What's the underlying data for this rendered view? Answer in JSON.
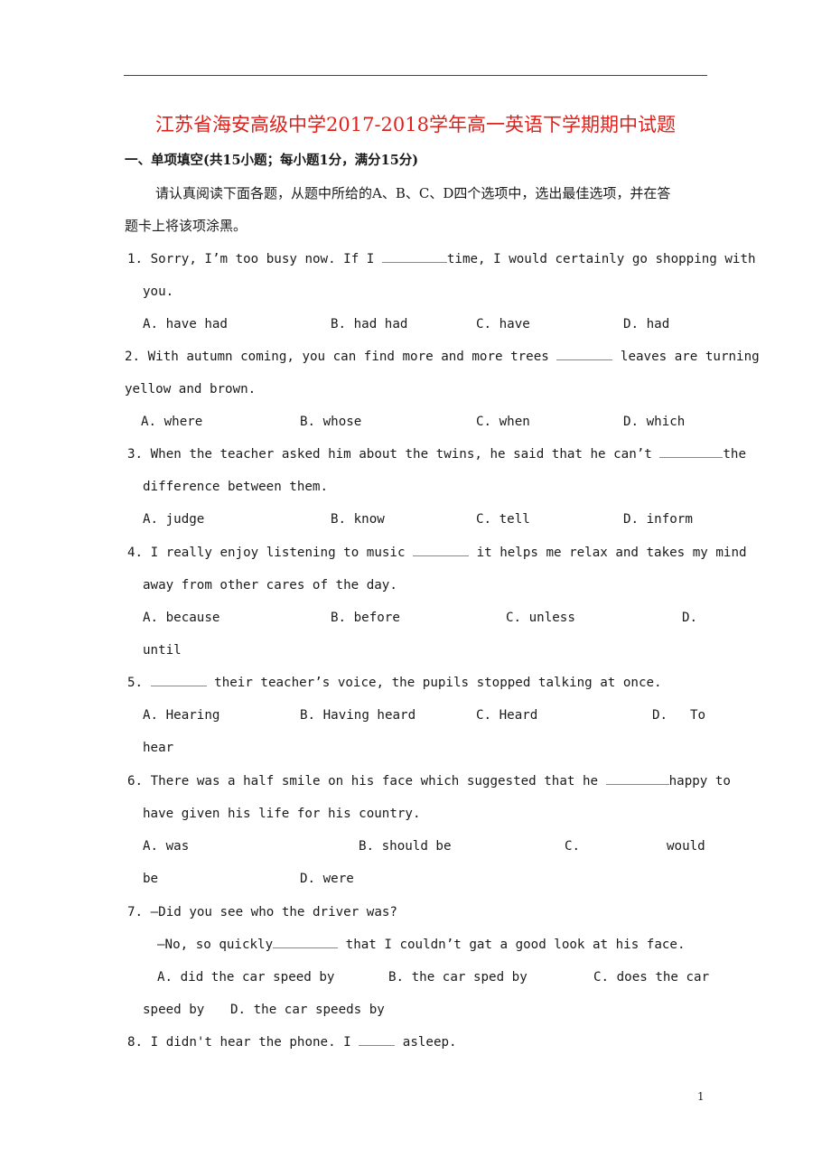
{
  "title": "江苏省海安高级中学2017-2018学年高一英语下学期期中试题",
  "section": "一、单项填空(共15小题；每小题1分，满分15分)",
  "instructions": {
    "line1": "请认真阅读下面各题，从题中所给的A、B、C、D四个选项中，选出最佳选项，并在答",
    "line2": "题卡上将该项涂黑。"
  },
  "questions": [
    {
      "number": "1.",
      "lines": [
        "Sorry, I’m too busy now. If I ",
        "time, I would certainly go shopping with",
        "you."
      ],
      "options": {
        "A": "A.  have had",
        "B": "B.  had had",
        "C": "C.  have",
        "D": "D.  had"
      }
    },
    {
      "number": "2.",
      "lines": [
        "With autumn coming, you can find more and more trees ",
        " leaves are turning",
        "yellow and brown."
      ],
      "options": {
        "A": "A.  where",
        "B": "B.  whose",
        "C": "C.  when",
        "D": "D.  which"
      }
    },
    {
      "number": "3.",
      "lines": [
        "When the teacher asked him about the twins, he said that he can’t ",
        "the",
        "difference between them."
      ],
      "options": {
        "A": "A.  judge",
        "B": "B.  know",
        "C": "C.  tell",
        "D": "D.  inform"
      }
    },
    {
      "number": "4.",
      "lines": [
        "I really enjoy listening to music ",
        " it helps me relax and takes my mind",
        "away from other cares of the day."
      ],
      "options": {
        "A": "A.  because",
        "B": "B.  before",
        "C": "C.  unless",
        "D": "D.",
        "D_cont": "until"
      }
    },
    {
      "number": "5.",
      "lines": [
        "",
        " their teacher’s voice, the pupils stopped talking at once."
      ],
      "options": {
        "A": "A.  Hearing",
        "B": "B.  Having heard",
        "C": "C.  Heard",
        "D": "D.",
        "D_word": "To",
        "D_cont": "hear"
      }
    },
    {
      "number": "6.",
      "lines": [
        "There was a half smile on his face which suggested that he ",
        "happy to",
        "have given his life for his country."
      ],
      "options": {
        "A": "A.  was",
        "B": "B.  should be",
        "C": "C.",
        "C_word": "would",
        "C_cont": "be",
        "D": "D.  were"
      }
    },
    {
      "number": "7.",
      "lines": [
        "—Did you see who the driver was?",
        "—No, so quickly",
        " that I couldn’t gat a good look at his face."
      ],
      "options": {
        "A": "A.  did the car speed by",
        "B": "B.  the car sped by",
        "C": "C.  does the car",
        "C_cont": "speed by",
        "D": "D.  the car speeds by"
      }
    },
    {
      "number": "8.",
      "lines": [
        "I didn't hear the phone. I ",
        " asleep."
      ]
    }
  ],
  "page_number": "1"
}
